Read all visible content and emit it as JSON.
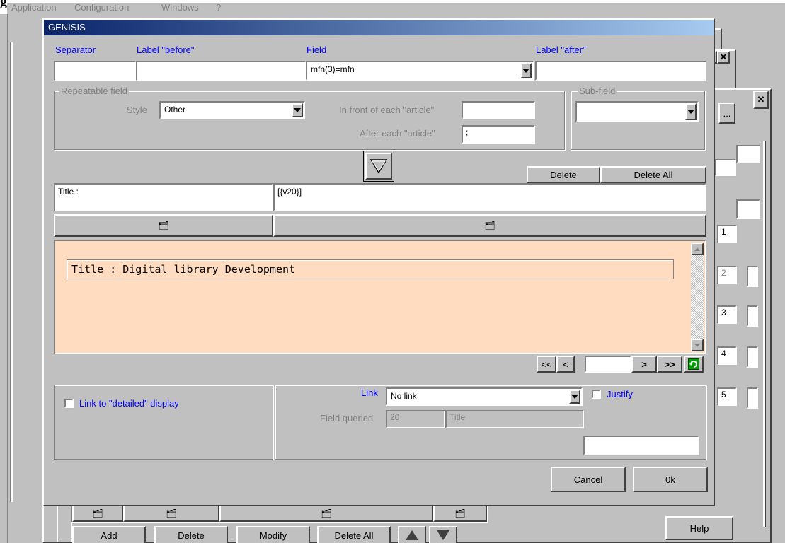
{
  "menu": {
    "items": [
      "Application",
      "Configuration",
      "Windows",
      "?"
    ]
  },
  "dialog": {
    "title": "GENISIS",
    "labels": {
      "separator": "Separator",
      "label_before": "Label \"before\"",
      "field": "Field",
      "label_after": "Label \"after\""
    },
    "inputs": {
      "separator_value": "",
      "label_before_value": "",
      "field_value": "mfn(3)=mfn",
      "label_after_value": ""
    },
    "repeatable": {
      "group_label": "Repeatable field",
      "style_label": "Style",
      "style_value": "Other",
      "in_front_label": "In front of each \"article\"",
      "in_front_value": "",
      "after_label": "After each \"article\"",
      "after_value": ";"
    },
    "subfield": {
      "group_label": "Sub-field",
      "value": ""
    },
    "buttons": {
      "delete": "Delete",
      "delete_all": "Delete All",
      "cancel": "Cancel",
      "ok": "0k"
    },
    "row": {
      "label": "Title :",
      "expression": "[{v20}]"
    },
    "preview": {
      "text": "Title : Digital library Development",
      "background": "#ffdcc0"
    },
    "bottom": {
      "link_detailed_label": "Link to \"detailed\" display",
      "link_label": "Link",
      "link_value": "No link",
      "justify_label": "Justify",
      "field_queried_label": "Field queried",
      "field_queried_number": "20",
      "field_queried_name": "Title",
      "extra_value": ""
    },
    "nav": {
      "first": "<<",
      "prev": "<",
      "next": ">",
      "last": ">>",
      "page_value": ""
    }
  },
  "background_window": {
    "buttons": {
      "add": "Add",
      "delete": "Delete",
      "modify": "Modify",
      "delete_all": "Delete All",
      "help": "Help",
      "ellipsis": "..."
    },
    "numbers": [
      "1",
      "2",
      "3",
      "4",
      "5"
    ]
  },
  "colors": {
    "titlebar_start": "#0a246a",
    "titlebar_end": "#a6caf0",
    "accent_blue": "#0000ff",
    "face": "#c0c0c0"
  }
}
